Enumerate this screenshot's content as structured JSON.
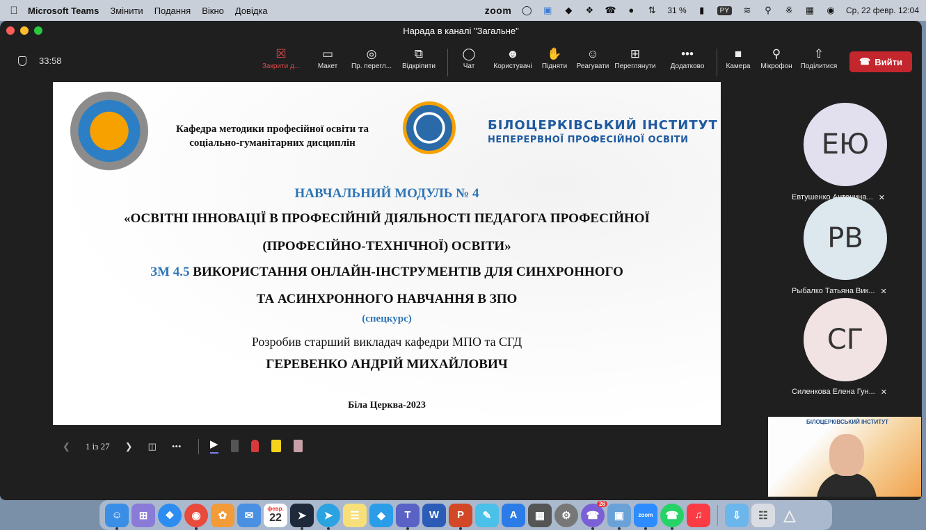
{
  "menubar": {
    "app_name": "Microsoft Teams",
    "menus": [
      "Змінити",
      "Подання",
      "Вікно",
      "Довідка"
    ],
    "zoom_label": "zoom",
    "battery": "31 %",
    "input_lang": "PY",
    "datetime": "Ср, 22 февр.  12:04"
  },
  "window": {
    "title": "Нарада в каналі \"Загальне\"",
    "timer": "33:58"
  },
  "toolbar": {
    "close_share": "Закрити д...",
    "layout": "Макет",
    "presenter_view": "Пр. перегл...",
    "pop_out": "Відкріпити",
    "chat": "Чат",
    "people": "Користувачі",
    "raise": "Підняти",
    "react": "Реагувати",
    "view": "Переглянути",
    "more": "Додатково",
    "camera": "Камера",
    "mic": "Мікрофон",
    "share": "Поділитися",
    "leave": "Вийти"
  },
  "slide": {
    "dept_line1": "Кафедра методики професійної освіти та",
    "dept_line2": "соціально-гуманітарних дисциплін",
    "inst_line1": "БІЛОЦЕРКІВСЬКИЙ ІНСТИТУТ",
    "inst_line2": "НЕПЕРЕРВНОЇ ПРОФЕСІЙНОЇ ОСВІТИ",
    "module": "НАВЧАЛЬНИЙ МОДУЛЬ № 4",
    "title_line1": "«ОСВІТНІ ІННОВАЦІЇ В ПРОФЕСІЙНІЙ ДІЯЛЬНОСТІ ПЕДАГОГА ПРОФЕСІЙНОЇ",
    "title_line2": "(ПРОФЕСІЙНО-ТЕХНІЧНОЇ) ОСВІТИ»",
    "zm_prefix": "ЗМ 4.5",
    "zm_line1": "ВИКОРИСТАННЯ ОНЛАЙН-ІНСТРУМЕНТІВ ДЛЯ СИНХРОННОГО",
    "zm_line2": "ТА АСИНХРОННОГО НАВЧАННЯ В ЗПО",
    "special": "(спецкурс)",
    "author_line": "Розробив старший викладач кафедри МПО та СГД",
    "author_name": "ГЕРЕВЕНКО АНДРІЙ МИХАЙЛОВИЧ",
    "place_year": "Біла Церква-2023"
  },
  "slide_controls": {
    "page": "1 із 27"
  },
  "participants": [
    {
      "initials": "ЕЮ",
      "name": "Евтушенко Антонина...",
      "color": "#e2e0ee"
    },
    {
      "initials": "РВ",
      "name": "Рыбалко Татьяна Вик...",
      "color": "#dce7ee"
    },
    {
      "initials": "СГ",
      "name": "Силенкова Елена Гун...",
      "color": "#f1e3e3"
    }
  ],
  "self_video": {
    "banner": "БІЛОЦЕРКІВСЬКИЙ ІНСТИТУТ"
  },
  "dock": {
    "calendar_month": "февр.",
    "calendar_day": "22",
    "viber_badge": "26"
  }
}
